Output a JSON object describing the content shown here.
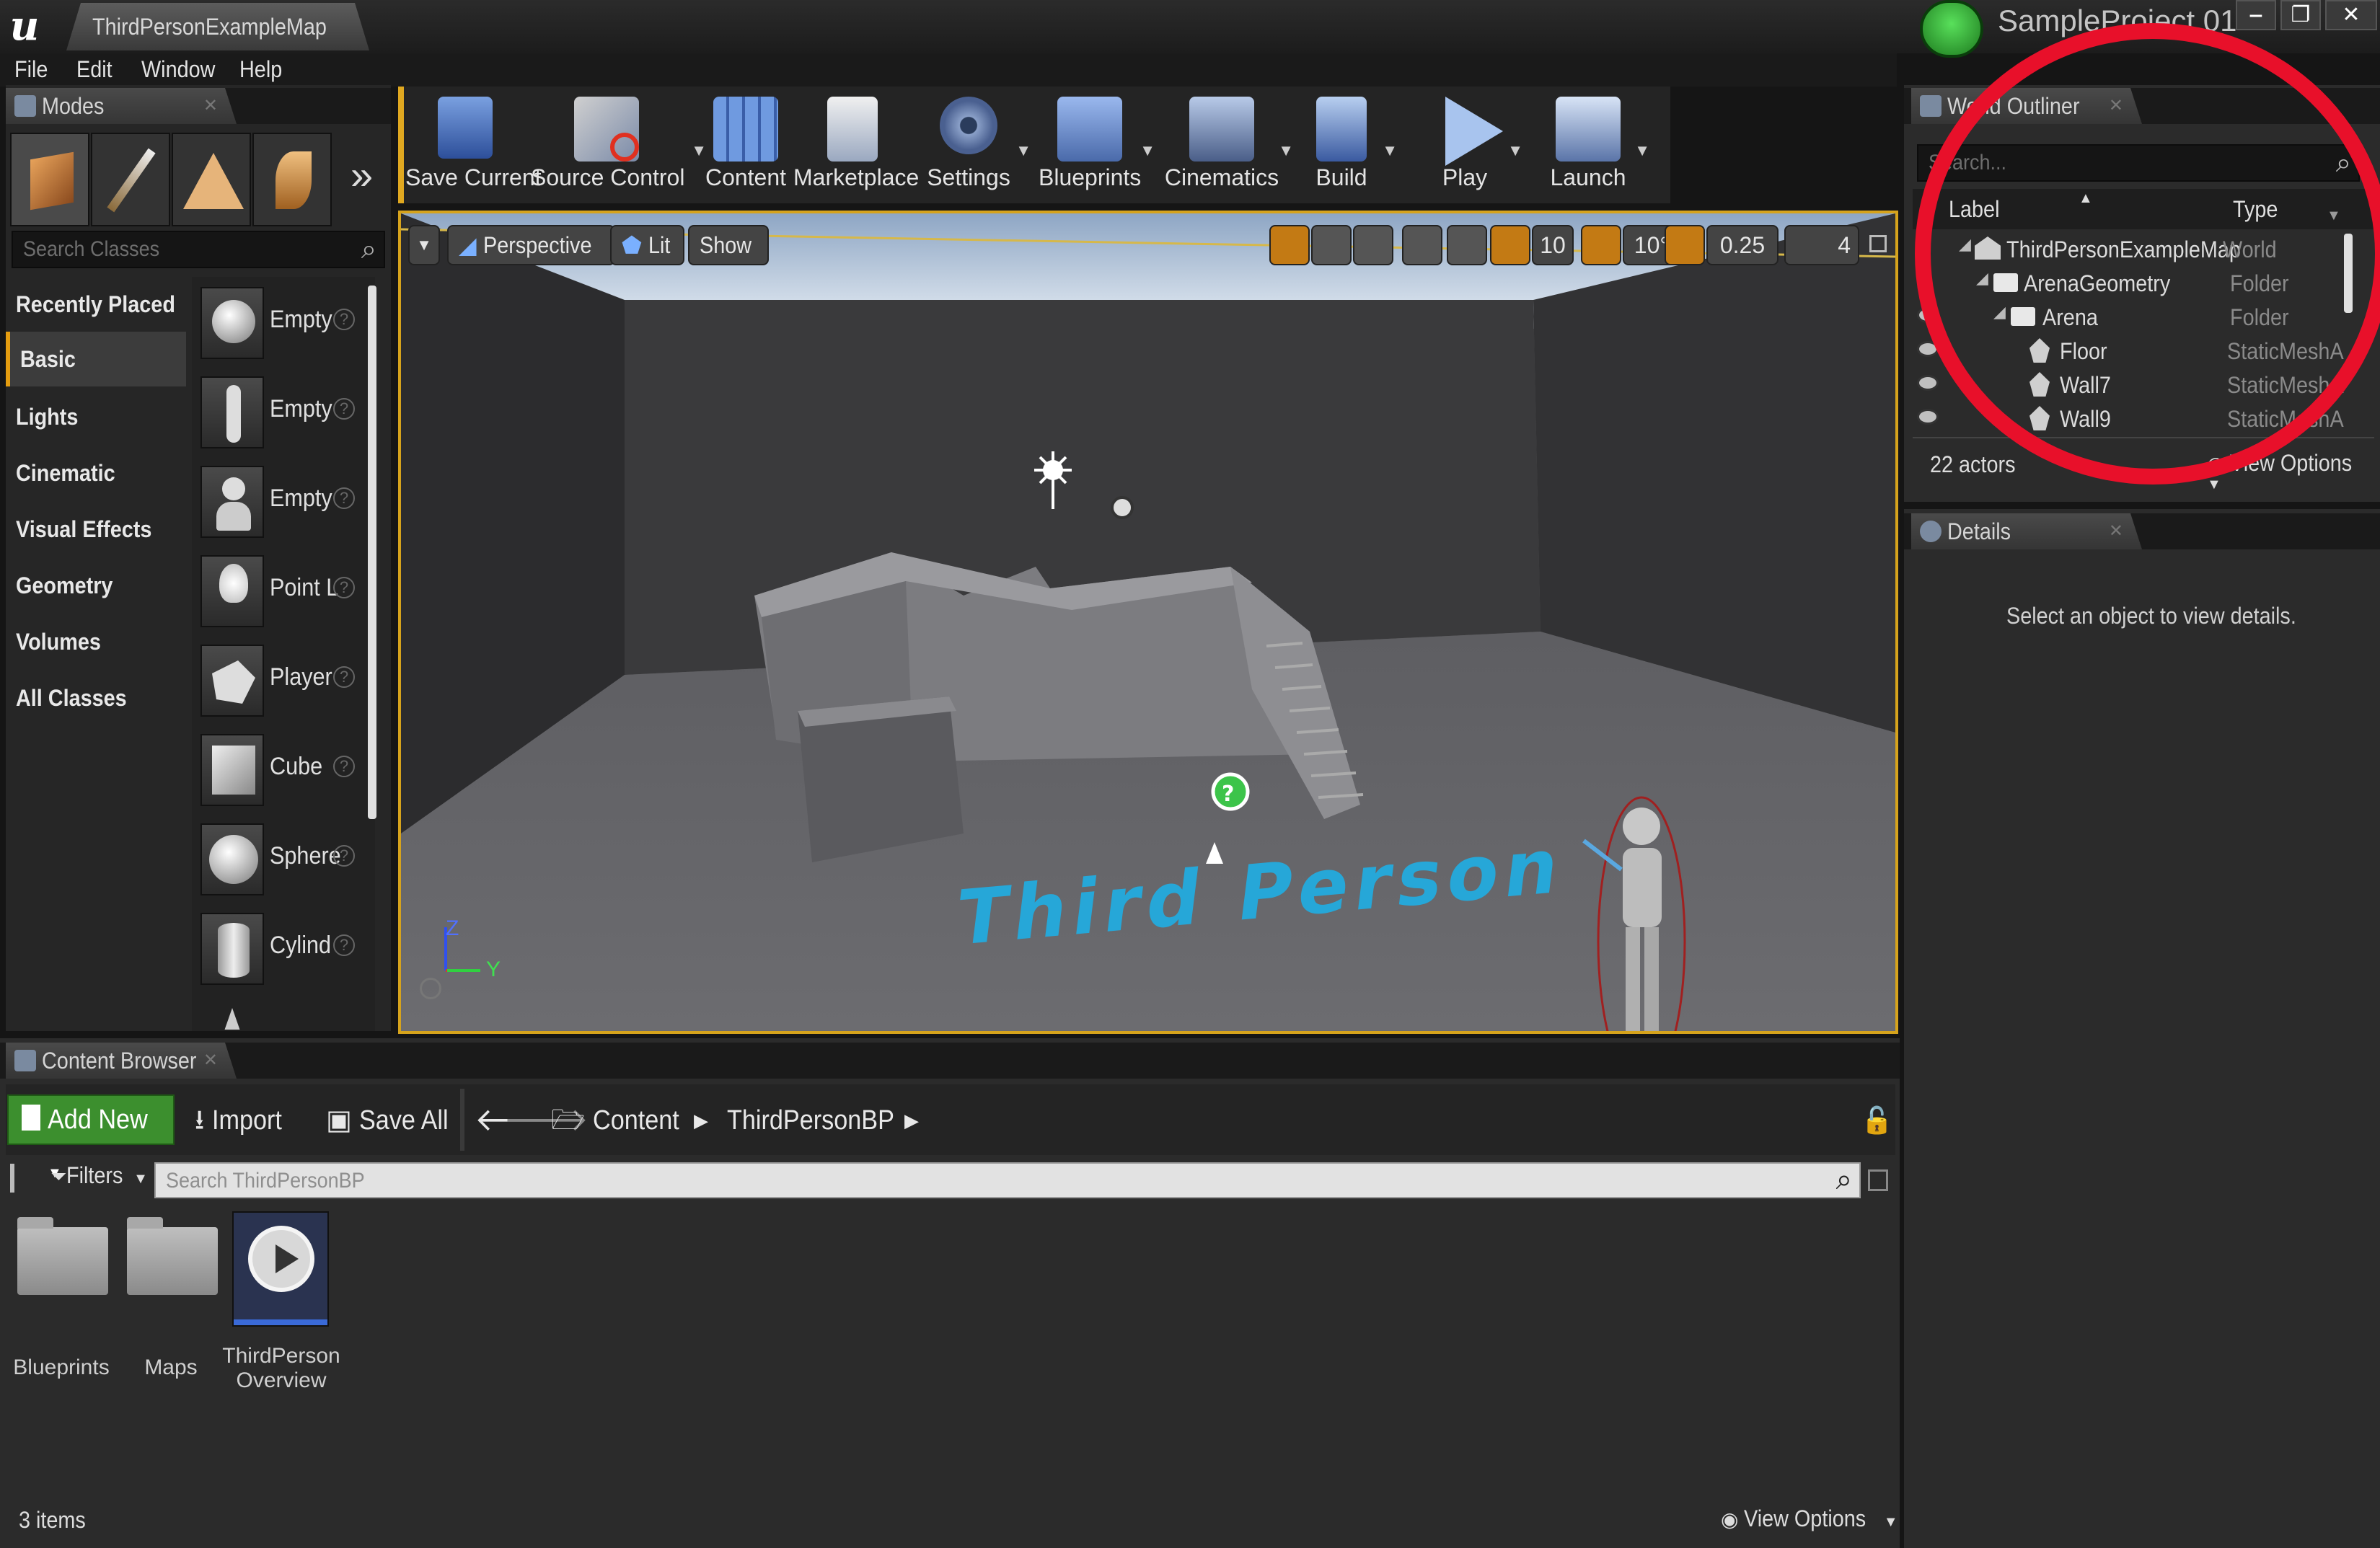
{
  "window": {
    "tab_title": "ThirdPersonExampleMap",
    "project_name": "SampleProject 01",
    "controls": {
      "minimize": "‒",
      "restore": "❐",
      "close": "✕"
    }
  },
  "menu": [
    "File",
    "Edit",
    "Window",
    "Help"
  ],
  "modes": {
    "tab_label": "Modes",
    "search_placeholder": "Search Classes",
    "categories": [
      "Recently Placed",
      "Basic",
      "Lights",
      "Cinematic",
      "Visual Effects",
      "Geometry",
      "Volumes",
      "All Classes"
    ],
    "selected_category": "Basic",
    "items": [
      "Empty",
      "Empty",
      "Empty",
      "Point L",
      "Player",
      "Cube",
      "Spherе",
      "Cylind"
    ]
  },
  "toolbar": {
    "buttons": [
      "Save Current",
      "Source Control",
      "Content",
      "Marketplace",
      "Settings",
      "Blueprints",
      "Cinematics",
      "Build",
      "Play",
      "Launch"
    ]
  },
  "viewport": {
    "perspective": "Perspective",
    "lit": "Lit",
    "show": "Show",
    "grid_snap": "10",
    "rotation_snap": "10°",
    "scale_snap": "0.25",
    "camera_speed": "4",
    "floor_text": "Third Person",
    "axis": {
      "z": "Z",
      "y": "Y"
    }
  },
  "outliner": {
    "tab_label": "World Outliner",
    "search_placeholder": "Search...",
    "col_label": "Label",
    "col_type": "Type",
    "rows": [
      {
        "label": "ThirdPersonExampleMap",
        "type": "World"
      },
      {
        "label": "ArenaGeometry",
        "type": "Folder"
      },
      {
        "label": "Arena",
        "type": "Folder"
      },
      {
        "label": "Floor",
        "type": "StaticMeshActor"
      },
      {
        "label": "Wall7",
        "type": "StaticMeshActor"
      },
      {
        "label": "Wall9",
        "type": "StaticMeshActor"
      }
    ],
    "actor_count": "22 actors",
    "view_options": "View Options"
  },
  "details": {
    "tab_label": "Details",
    "empty_message": "Select an object to view details."
  },
  "content_browser": {
    "tab_label": "Content Browser",
    "add_new": "Add New",
    "import": "Import",
    "save_all": "Save All",
    "path": [
      "Content",
      "ThirdPersonBP"
    ],
    "filters": "Filters",
    "search_placeholder": "Search ThirdPersonBP",
    "assets": [
      {
        "label": "Blueprints"
      },
      {
        "label": "Maps"
      },
      {
        "label_line1": "ThirdPerson",
        "label_line2": "Overview"
      }
    ],
    "item_count": "3 items",
    "view_options": "View Options"
  },
  "colors": {
    "accent": "#e59d10",
    "annotation": "#e8102a",
    "add_new": "#3c8f2e"
  }
}
